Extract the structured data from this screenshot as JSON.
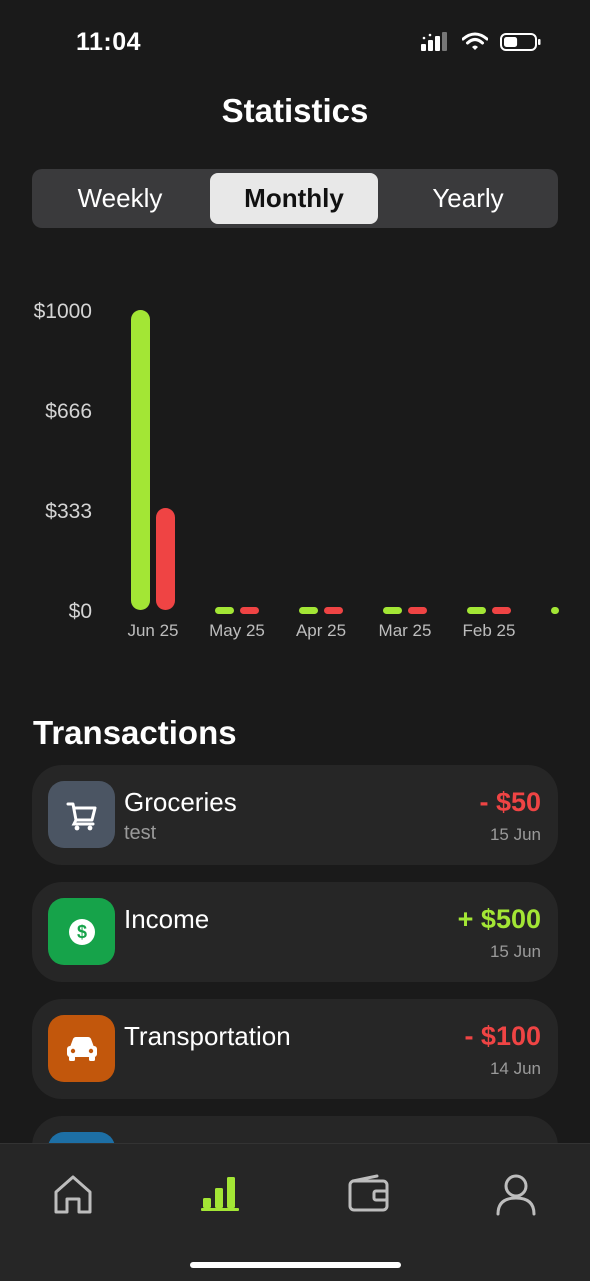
{
  "status_bar": {
    "time": "11:04",
    "battery_level": 0.45
  },
  "page": {
    "title": "Statistics"
  },
  "segments": {
    "weekly": "Weekly",
    "monthly": "Monthly",
    "yearly": "Yearly",
    "selected": "Monthly"
  },
  "chart_data": {
    "type": "bar",
    "categories": [
      "Jun 25",
      "May 25",
      "Apr 25",
      "Mar 25",
      "Feb 25"
    ],
    "series": [
      {
        "values": [
          1000,
          0,
          0,
          0,
          0
        ],
        "color": "#a3e635"
      },
      {
        "values": [
          340,
          0,
          0,
          0,
          0
        ],
        "color": "#ef4444"
      }
    ],
    "yticks": [
      "$1000",
      "$666",
      "$333",
      "$0"
    ],
    "ylim": [
      0,
      1000
    ]
  },
  "transactions": {
    "header": "Transactions",
    "items": [
      {
        "name": "Groceries",
        "note": "test",
        "amount": "- $50",
        "date": "15 Jun",
        "type": "expense",
        "icon": "cart-icon",
        "icon_bg": "#4b5563"
      },
      {
        "name": "Income",
        "note": "",
        "amount": "+ $500",
        "date": "15 Jun",
        "type": "income",
        "icon": "dollar-icon",
        "icon_bg": "#16a34a"
      },
      {
        "name": "Transportation",
        "note": "",
        "amount": "- $100",
        "date": "14 Jun",
        "type": "expense",
        "icon": "car-icon",
        "icon_bg": "#c2570c"
      }
    ]
  },
  "colors": {
    "accent": "#a3e635",
    "expense": "#ef4444",
    "income": "#a3e635"
  },
  "tabs": {
    "active": "stats",
    "items": [
      "home-icon",
      "stats-icon",
      "wallet-icon",
      "profile-icon"
    ]
  }
}
